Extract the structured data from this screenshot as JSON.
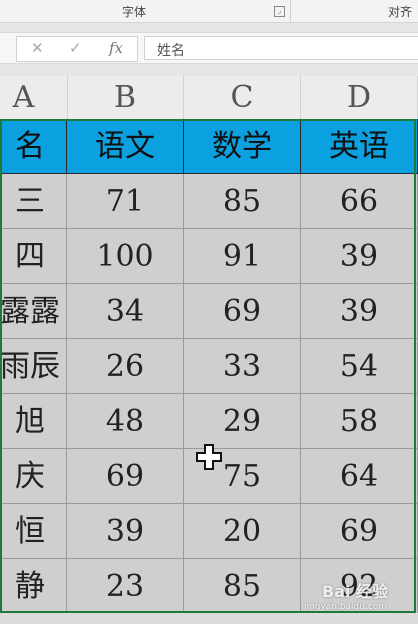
{
  "ribbon": {
    "font_group": "字体",
    "align_group": "对齐"
  },
  "formula_bar": {
    "cancel_icon": "✕",
    "enter_icon": "✓",
    "fx_icon": "fx",
    "value": "姓名"
  },
  "columns": [
    "A",
    "B",
    "C",
    "D"
  ],
  "table": {
    "header": [
      "名",
      "语文",
      "数学",
      "英语"
    ],
    "rows": [
      [
        "三",
        "71",
        "85",
        "66"
      ],
      [
        "四",
        "100",
        "91",
        "39"
      ],
      [
        "露露",
        "34",
        "69",
        "39"
      ],
      [
        "雨辰",
        "26",
        "33",
        "54"
      ],
      [
        "旭",
        "48",
        "29",
        "58"
      ],
      [
        "庆",
        "69",
        "75",
        "64"
      ],
      [
        "恒",
        "39",
        "20",
        "69"
      ],
      [
        "静",
        "23",
        "85",
        "92"
      ]
    ]
  },
  "colors": {
    "header_fill": "#0ba0df",
    "cell_fill": "#cfcfcf",
    "selection_border": "#1e7a3c"
  },
  "watermark": {
    "logo": "Bai 经验",
    "url": "jingyan.baidu.com"
  }
}
